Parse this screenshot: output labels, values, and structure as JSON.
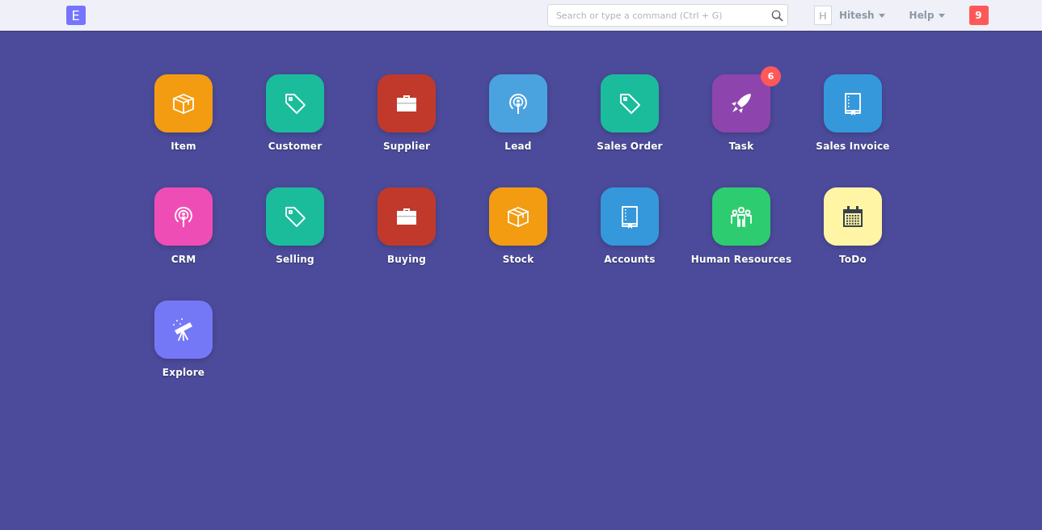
{
  "navbar": {
    "logo": "E",
    "search": {
      "placeholder": "Search or type a command (Ctrl + G)"
    },
    "user": {
      "avatar": "H",
      "name": "Hitesh"
    },
    "help": "Help",
    "notifications": "9"
  },
  "modules": [
    {
      "label": "Item",
      "kind": "box",
      "color": "#f39c12"
    },
    {
      "label": "Customer",
      "kind": "tag",
      "color": "#1abc9c"
    },
    {
      "label": "Supplier",
      "kind": "briefcase",
      "color": "#c0392b"
    },
    {
      "label": "Lead",
      "kind": "broadcast",
      "color": "#4aa3df"
    },
    {
      "label": "Sales Order",
      "kind": "tag",
      "color": "#1abc9c"
    },
    {
      "label": "Task",
      "kind": "rocket",
      "color": "#8e44ad",
      "badge": "6"
    },
    {
      "label": "Sales Invoice",
      "kind": "book",
      "color": "#3498db"
    },
    {
      "label": "CRM",
      "kind": "broadcast",
      "color": "#ef4db6"
    },
    {
      "label": "Selling",
      "kind": "tag",
      "color": "#1abc9c"
    },
    {
      "label": "Buying",
      "kind": "briefcase",
      "color": "#c0392b"
    },
    {
      "label": "Stock",
      "kind": "box",
      "color": "#f39c12"
    },
    {
      "label": "Accounts",
      "kind": "book",
      "color": "#3498db"
    },
    {
      "label": "Human Resources",
      "kind": "people",
      "color": "#2ecc71"
    },
    {
      "label": "ToDo",
      "kind": "calendar",
      "color": "#fff5a5"
    },
    {
      "label": "Explore",
      "kind": "telescope",
      "color": "#7578f6"
    }
  ]
}
